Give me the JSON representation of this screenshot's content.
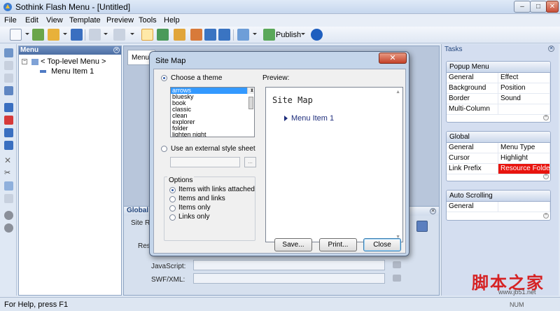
{
  "window": {
    "title": "Sothink Flash Menu - [Untitled]",
    "min": "–",
    "max": "□",
    "close": "✕"
  },
  "menubar": [
    "File",
    "Edit",
    "View",
    "Template",
    "Preview",
    "Tools",
    "Help"
  ],
  "toolbar": {
    "publish_label": "Publish"
  },
  "menu_panel": {
    "title": "Menu",
    "tree": {
      "root": "< Top-level Menu >",
      "child": "Menu Item 1"
    }
  },
  "workarea": {
    "tab_label": "Menu",
    "global_panel": {
      "title": "Global",
      "site_root_label": "Site Roo",
      "resource_label": "Reso",
      "javascript_label": "JavaScript:",
      "swfxml_label": "SWF/XML:"
    }
  },
  "tasks": {
    "title": "Tasks",
    "groups": [
      {
        "title": "Popup Menu",
        "items": [
          "General",
          "Effect",
          "Background",
          "Position",
          "Border",
          "Sound",
          "Multi-Column",
          ""
        ]
      },
      {
        "title": "Global",
        "items": [
          "General",
          "Menu Type",
          "Cursor",
          "Highlight",
          "Link Prefix",
          "Resource Folder"
        ],
        "highlighted": "Resource Folder"
      },
      {
        "title": "Auto Scrolling",
        "items": [
          "General",
          ""
        ]
      }
    ]
  },
  "dialog": {
    "title": "Site Map",
    "close": "✕",
    "choose_theme_label": "Choose a theme",
    "themes": [
      "arrows",
      "bluesky",
      "book",
      "classic",
      "clean",
      "explorer",
      "folder",
      "lighten night"
    ],
    "selected_theme": "arrows",
    "external_css_label": "Use an external style sheet",
    "browse": "...",
    "options_title": "Options",
    "options": [
      "Items with links attached",
      "Items and links",
      "Items only",
      "Links only"
    ],
    "preview_label": "Preview:",
    "preview_title": "Site Map",
    "preview_item": "Menu Item 1",
    "buttons": {
      "save": "Save...",
      "print": "Print...",
      "close": "Close"
    }
  },
  "status": {
    "text": "For Help, press F1",
    "indicator": "NUM"
  },
  "watermark": {
    "cn": "脚本之家",
    "url": "www.jb51.net"
  },
  "colors": {
    "accent": "#3399ff",
    "highlight_red": "#e8140e",
    "title_gradient_top": "#dfeaf7"
  }
}
